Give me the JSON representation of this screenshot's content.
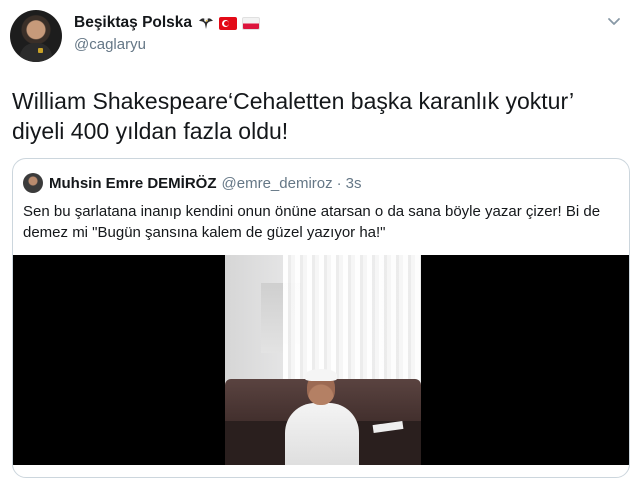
{
  "author": {
    "display_name": "Beşiktaş Polska",
    "handle": "@caglaryu",
    "emojis": [
      "eagle-icon",
      "flag-turkey-icon",
      "flag-poland-icon"
    ]
  },
  "tweet": {
    "text": "William Shakespeare‘Cehaletten başka karanlık yoktur’ diyeli 400 yıldan fazla oldu!"
  },
  "quoted_tweet": {
    "display_name": "Muhsin Emre DEMİRÖZ",
    "handle": "@emre_demiroz",
    "separator": "·",
    "time": "3s",
    "text": "Sen bu şarlatana inanıp kendini onun önüne atarsan o da sana böyle yazar çizer! Bi de demez mi \"Bugün şansına kalem de güzel yazıyor ha!\""
  },
  "colors": {
    "text_primary": "#14171a",
    "text_secondary": "#657786",
    "border": "#ccd6dd"
  }
}
